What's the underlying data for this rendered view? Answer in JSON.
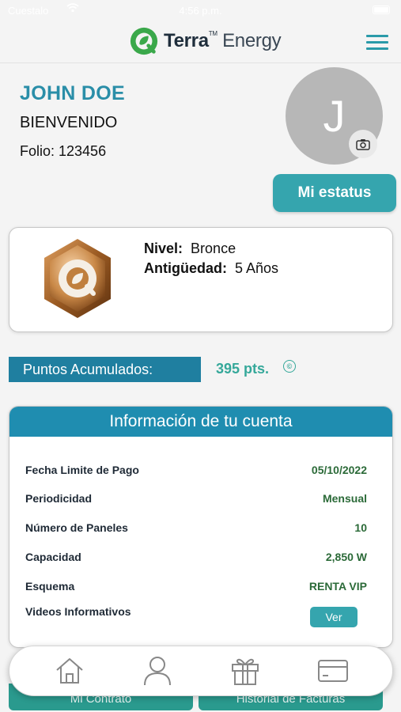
{
  "status_bar": {
    "carrier": "Cuestalo",
    "time": "4:56 p.m."
  },
  "header": {
    "brand_bold": "Terra",
    "brand_light": "Energy",
    "brand_mark": "TM",
    "logo_icon": "terra-leaf-logo",
    "menu_icon": "hamburger-menu-icon"
  },
  "profile": {
    "name": "JOHN DOE",
    "greeting": "BIENVENIDO",
    "folio": "Folio: 123456",
    "avatar_initial": "J",
    "status_button": "Mi estatus"
  },
  "level": {
    "nivel_label": "Nivel:",
    "nivel_value": "Bronce",
    "antiguedad_label": "Antigüedad:",
    "antiguedad_value": "5 Años",
    "badge_icon": "bronze-hexagon-badge"
  },
  "points": {
    "label": "Puntos Acumulados:",
    "value": "395 pts.",
    "icon": "copyright-circle-icon"
  },
  "account": {
    "title": "Información de tu cuenta",
    "rows": [
      {
        "label": "Fecha Limite de Pago",
        "value": "05/10/2022"
      },
      {
        "label": "Periodicidad",
        "value": "Mensual"
      },
      {
        "label": "Número de Paneles",
        "value": "10"
      },
      {
        "label": "Capacidad",
        "value": "2,850 W"
      },
      {
        "label": "Esquema",
        "value": "RENTA VIP"
      },
      {
        "label": "Videos Informativos",
        "button": "Ver"
      }
    ]
  },
  "bottom_buttons": {
    "left": "Mi Contrato",
    "right": "Historial de Facturas"
  },
  "tab_bar": {
    "tabs": [
      {
        "icon": "home-icon"
      },
      {
        "icon": "user-icon"
      },
      {
        "icon": "gift-icon"
      },
      {
        "icon": "credit-card-icon"
      }
    ]
  },
  "colors": {
    "primary_teal": "#35a5ae",
    "header_blue": "#1f8db0",
    "name_blue": "#2a8ea8",
    "value_green": "#2b6a38",
    "points_green": "#35a89a"
  }
}
